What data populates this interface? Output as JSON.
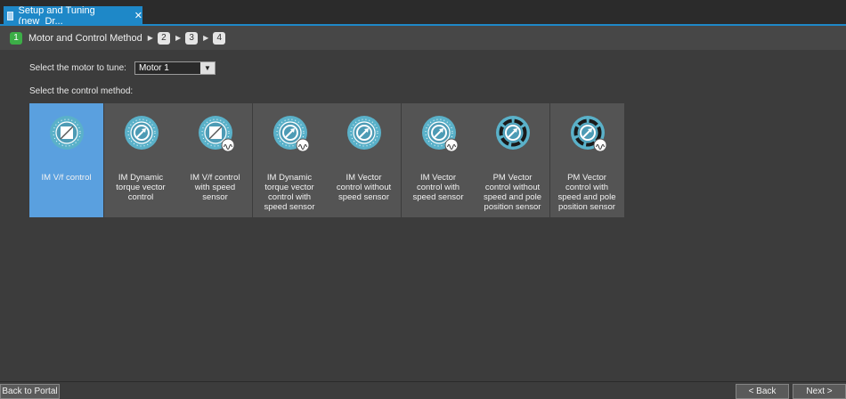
{
  "window": {
    "tab_title": "Setup and Tuning (new_Dr...",
    "close_glyph": "✕",
    "accent_color": "#1e88c8"
  },
  "steps": {
    "current_number": "1",
    "current_label": "Motor and Control Method",
    "next_steps": [
      "2",
      "3",
      "4"
    ],
    "arrow_glyph": "▶",
    "active_color": "#3cae47"
  },
  "motor": {
    "label": "Select the motor to tune:",
    "selected": "Motor 1",
    "dropdown_glyph": "▼"
  },
  "control": {
    "label": "Select the control method:",
    "selected_color": "#5aa0df",
    "tiles": [
      {
        "label": "IM V/f control",
        "icon": "im-vf-icon",
        "selected": true
      },
      {
        "label": "IM Dynamic torque vector control",
        "icon": "im-dynamic-torque-icon",
        "selected": false
      },
      {
        "label": "IM V/f control with speed sensor",
        "icon": "im-vf-speed-sensor-icon",
        "selected": false
      },
      {
        "label": "IM Dynamic torque vector control with speed sensor",
        "icon": "im-dynamic-torque-speed-sensor-icon",
        "selected": false
      },
      {
        "label": "IM Vector control without speed sensor",
        "icon": "im-vector-icon",
        "selected": false
      },
      {
        "label": "IM Vector control with speed sensor",
        "icon": "im-vector-speed-sensor-icon",
        "selected": false
      },
      {
        "label": "PM Vector control without speed and pole position sensor",
        "icon": "pm-vector-icon",
        "selected": false
      },
      {
        "label": "PM Vector control with speed and pole position sensor",
        "icon": "pm-vector-sensor-icon",
        "selected": false
      }
    ]
  },
  "footer": {
    "back_to_portal": "Back to Portal",
    "back": "< Back",
    "next": "Next >"
  }
}
